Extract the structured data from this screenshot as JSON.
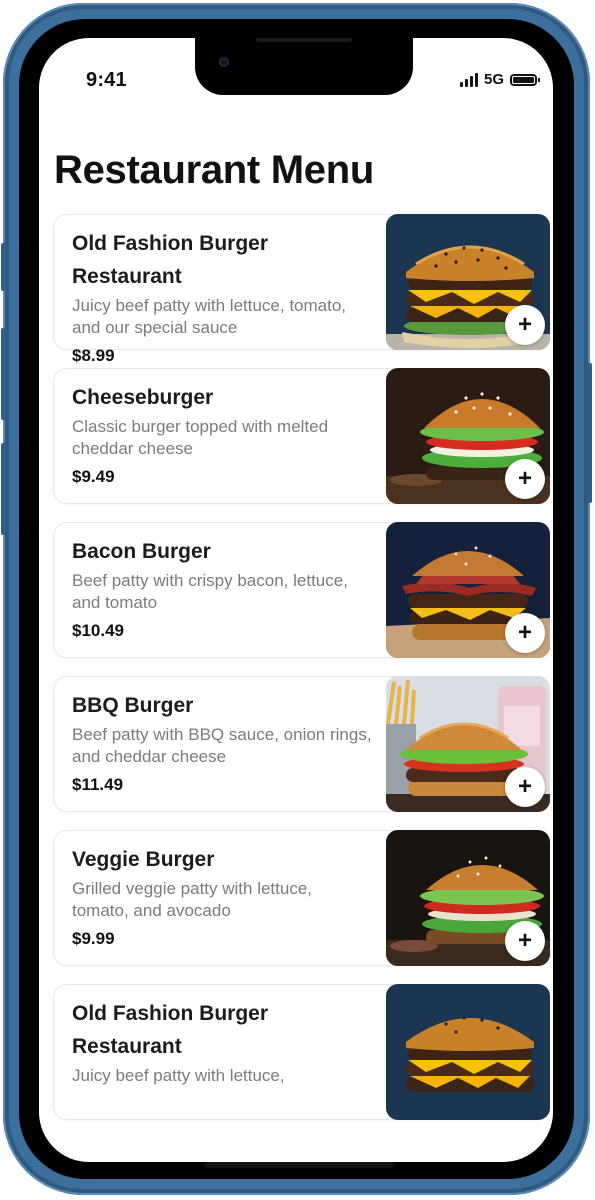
{
  "status": {
    "time": "9:41",
    "network": "5G"
  },
  "page": {
    "title": "Restaurant Menu"
  },
  "colors": {
    "frame": "#3c6f9c",
    "price": "#111111",
    "description": "#7b7b80",
    "add_button_bg": "#ffffff"
  },
  "menu": {
    "items": [
      {
        "name": "Old Fashion Burger Restaurant",
        "description": "Juicy beef patty with lettuce, tomato, and our special sauce",
        "price": "$8.99",
        "image": "double-cheeseburger-photo",
        "add_icon": "+"
      },
      {
        "name": "Cheeseburger",
        "description": "Classic burger topped with melted cheddar cheese",
        "price": "$9.49",
        "image": "cheeseburger-photo",
        "add_icon": "+"
      },
      {
        "name": "Bacon Burger",
        "description": "Beef patty with crispy bacon, lettuce, and tomato",
        "price": "$10.49",
        "image": "bacon-burger-photo",
        "add_icon": "+"
      },
      {
        "name": "BBQ Burger",
        "description": "Beef patty with BBQ sauce, onion rings, and cheddar cheese",
        "price": "$11.49",
        "image": "bbq-burger-photo",
        "add_icon": "+"
      },
      {
        "name": "Veggie Burger",
        "description": "Grilled veggie patty with lettuce, tomato, and avocado",
        "price": "$9.99",
        "image": "veggie-burger-photo",
        "add_icon": "+"
      },
      {
        "name": "Old Fashion Burger Restaurant",
        "description": "Juicy beef patty with lettuce,",
        "price": "",
        "image": "double-cheeseburger-photo",
        "add_icon": ""
      }
    ]
  }
}
